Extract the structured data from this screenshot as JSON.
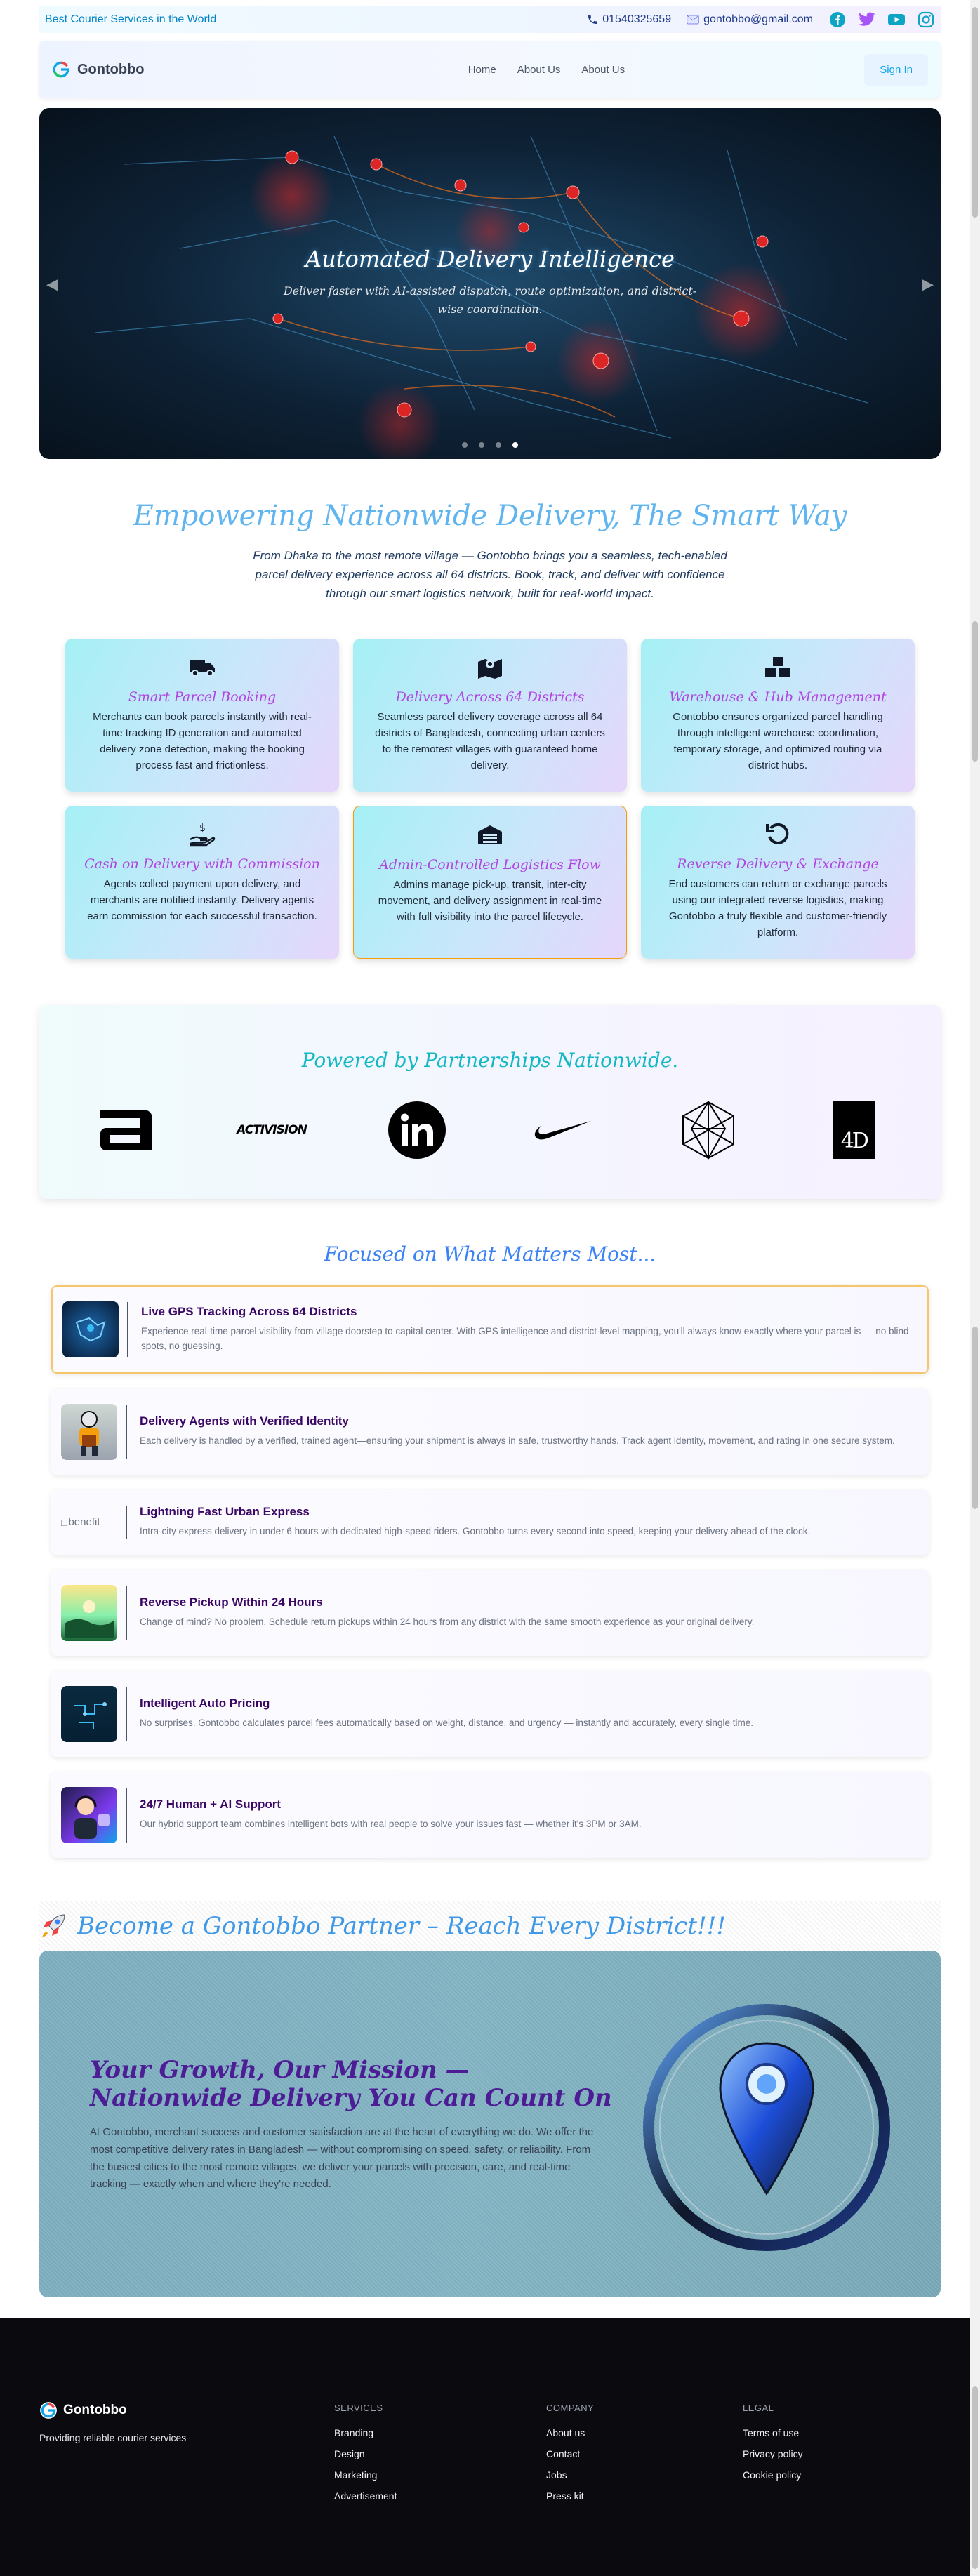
{
  "topbar": {
    "tagline": "Best Courier Services in the World",
    "phone": "01540325659",
    "email": "gontobbo@gmail.com",
    "social_icons": [
      "facebook-icon",
      "twitter-icon",
      "youtube-icon",
      "instagram-icon"
    ]
  },
  "navbar": {
    "brand": "Gontobbo",
    "links": [
      "Home",
      "About Us",
      "About Us"
    ],
    "signin": "Sign In"
  },
  "hero": {
    "title": "Automated Delivery Intelligence",
    "subtitle": "Deliver faster with AI-assisted dispatch, route optimization, and district-wise coordination.",
    "slides": 4,
    "active_slide": 4
  },
  "intro": {
    "title": "Empowering Nationwide Delivery, The Smart Way",
    "text": "From Dhaka to the most remote village — Gontobbo brings you a seamless, tech-enabled parcel delivery experience across all 64 districts. Book, track, and deliver with confidence through our smart logistics network, built for real-world impact."
  },
  "features": [
    {
      "title": "Smart Parcel Booking",
      "text": "Merchants can book parcels instantly with real-time tracking ID generation and automated delivery zone detection, making the booking process fast and frictionless.",
      "icon": "truck-icon"
    },
    {
      "title": "Delivery Across 64 Districts",
      "text": "Seamless parcel delivery coverage across all 64 districts of Bangladesh, connecting urban centers to the remotest villages with guaranteed home delivery.",
      "icon": "map-pin-icon"
    },
    {
      "title": "Warehouse & Hub Management",
      "text": "Gontobbo ensures organized parcel handling through intelligent warehouse coordination, temporary storage, and optimized routing via district hubs.",
      "icon": "boxes-icon"
    },
    {
      "title": "Cash on Delivery with Commission",
      "text": "Agents collect payment upon delivery, and merchants are notified instantly. Delivery agents earn commission for each successful transaction.",
      "icon": "hand-money-icon"
    },
    {
      "title": "Admin-Controlled Logistics Flow",
      "text": "Admins manage pick-up, transit, inter-city movement, and delivery assignment in real-time with full visibility into the parcel lifecycle.",
      "icon": "warehouse-icon"
    },
    {
      "title": "Reverse Delivery & Exchange",
      "text": "End customers can return or exchange parcels using our integrated reverse logistics, making Gontobbo a truly flexible and customer-friendly platform.",
      "icon": "undo-icon"
    }
  ],
  "partners": {
    "title": "Powered by Partnerships Nationwide.",
    "logos": [
      "abbott-logo",
      "activision-logo",
      "linkedin-logo",
      "nike-logo",
      "geometric-logo",
      "4d-logo"
    ],
    "activision_text": "ACTIVISION",
    "fourd_text": "4D"
  },
  "focus": {
    "title": "Focused on What Matters Most...",
    "broken_alt": "benefit",
    "items": [
      {
        "title": "Live GPS Tracking Across 64 Districts",
        "text": "Experience real-time parcel visibility from village doorstep to capital center. With GPS intelligence and district-level mapping, you'll always know exactly where your parcel is — no blind spots, no guessing."
      },
      {
        "title": "Delivery Agents with Verified Identity",
        "text": "Each delivery is handled by a verified, trained agent—ensuring your shipment is always in safe, trustworthy hands. Track agent identity, movement, and rating in one secure system."
      },
      {
        "title": "Lightning Fast Urban Express",
        "text": "Intra-city express delivery in under 6 hours with dedicated high-speed riders. Gontobbo turns every second into speed, keeping your delivery ahead of the clock."
      },
      {
        "title": "Reverse Pickup Within 24 Hours",
        "text": "Change of mind? No problem. Schedule return pickups within 24 hours from any district with the same smooth experience as your original delivery."
      },
      {
        "title": "Intelligent Auto Pricing",
        "text": "No surprises. Gontobbo calculates parcel fees automatically based on weight, distance, and urgency — instantly and accurately, every single time."
      },
      {
        "title": "24/7 Human + AI Support",
        "text": "Our hybrid support team combines intelligent bots with real people to solve your issues fast — whether it's 3PM or 3AM."
      }
    ]
  },
  "become_partner": {
    "title": "Become a Gontobbo Partner – Reach Every District!!!",
    "growth_title": "Your Growth, Our Mission — Nationwide Delivery You Can Count On",
    "growth_text": "At Gontobbo, merchant success and customer satisfaction are at the heart of everything we do. We offer the most competitive delivery rates in Bangladesh — without compromising on speed, safety, or reliability. From the busiest cities to the most remote villages, we deliver your parcels with precision, care, and real-time tracking — exactly when and where they're needed."
  },
  "footer": {
    "brand": "Gontobbo",
    "tagline": "Providing reliable courier services",
    "columns": [
      {
        "title": "SERVICES",
        "links": [
          "Branding",
          "Design",
          "Marketing",
          "Advertisement"
        ]
      },
      {
        "title": "COMPANY",
        "links": [
          "About us",
          "Contact",
          "Jobs",
          "Press kit"
        ]
      },
      {
        "title": "LEGAL",
        "links": [
          "Terms of use",
          "Privacy policy",
          "Cookie policy"
        ]
      }
    ]
  },
  "colors": {
    "accent": "#0ea5e9",
    "feature_title": "#b144e0",
    "benefit_title": "#3b0764",
    "growth_title": "#4c1d95",
    "footer_bg": "#0b0b0f"
  }
}
